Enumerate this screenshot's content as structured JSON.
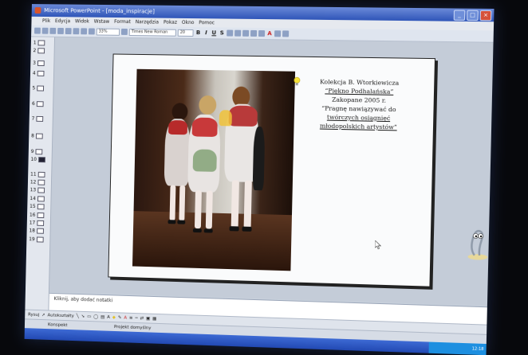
{
  "window": {
    "title": "Microsoft PowerPoint - [moda_inspiracje]",
    "buttons": [
      "_",
      "□",
      "×"
    ]
  },
  "menu": [
    "Plik",
    "Edycja",
    "Widok",
    "Wstaw",
    "Format",
    "Narzędzia",
    "Pokaz",
    "Okno",
    "Pomoc"
  ],
  "toolbar": {
    "zoom": "33%",
    "font": "Times New Roman",
    "size": "20",
    "bold": "B",
    "italic": "I",
    "underline": "U",
    "shadow": "S",
    "font_color": "A"
  },
  "slides": [
    "1",
    "2",
    "3",
    "4",
    "5",
    "6",
    "7",
    "8",
    "9",
    "10",
    "11",
    "12",
    "13",
    "14",
    "15",
    "16",
    "17",
    "18",
    "19"
  ],
  "active_slide": "10",
  "slide": {
    "lines": [
      "Kolekcja B. Wtorkiewicza",
      "“Piękno Podhalańska”",
      "Zakopane 2005 r.",
      "“Pragnę nawiązywać do",
      "twórczych osiągnięć",
      "młodopolskich artystów”"
    ]
  },
  "notes": {
    "placeholder": "Kliknij, aby dodać notatki"
  },
  "drawbar": {
    "rysuj": "Rysuj",
    "autoshapes": "Autokształty"
  },
  "status": {
    "view": "Konspekt",
    "design": "Projekt domyślny"
  },
  "tray": {
    "time": "12:18"
  }
}
